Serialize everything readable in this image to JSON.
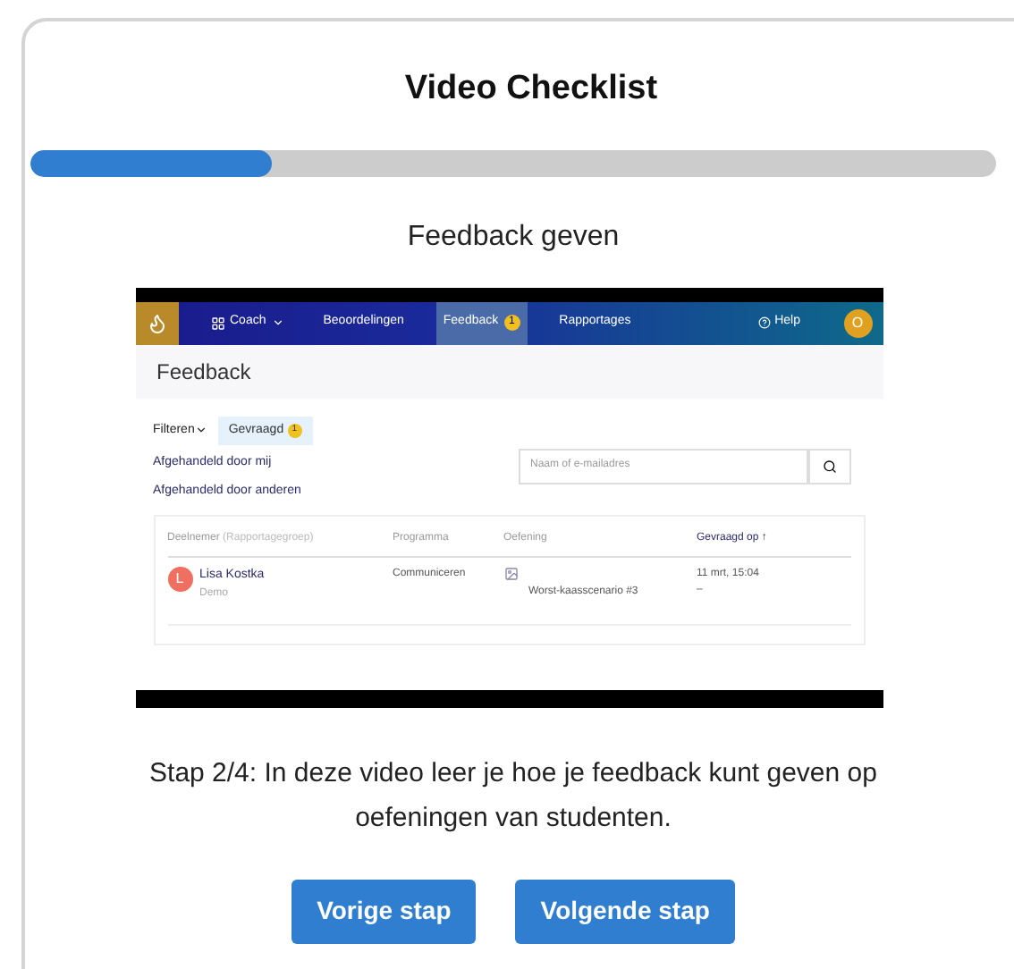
{
  "title": "Video Checklist",
  "progress": {
    "level": 0.25
  },
  "step_title": "Feedback geven",
  "video": {
    "nav": {
      "items": [
        {
          "label": "Coach",
          "kind": "menu",
          "selected": false
        },
        {
          "label": "Beoordelingen",
          "kind": "link",
          "selected": false
        },
        {
          "label": "Feedback",
          "kind": "link",
          "selected": true,
          "badge": "1"
        },
        {
          "label": "Rapportages",
          "kind": "link",
          "selected": false
        }
      ],
      "help": "Help",
      "avatar": "O"
    },
    "page_title": "Feedback",
    "filter": "Filteren",
    "tab": {
      "label": "Gevraagd",
      "badge": "1"
    },
    "links": [
      "Afgehandeld door mij",
      "Afgehandeld door anderen"
    ],
    "search": {
      "placeholder": "Naam of e-mailadres"
    },
    "table": {
      "columns": [
        {
          "label": "Deelnemer",
          "note": "(Rapportagegroep)"
        },
        {
          "label": "Programma"
        },
        {
          "label": "Oefening"
        },
        {
          "label": "Gevraagd op ↑"
        }
      ],
      "rows": [
        {
          "initial": "L",
          "name": "Lisa Kostka",
          "group": "Demo",
          "program": "Communiceren",
          "exercise": "Worst-kaasscenario #3",
          "date": "11 mrt, 15:04",
          "extra": "–"
        }
      ]
    }
  },
  "description": "Stap 2/4: In deze video leer je hoe je feedback kunt geven op oefeningen van studenten.",
  "buttons": [
    "Vorige stap",
    "Volgende stap"
  ]
}
